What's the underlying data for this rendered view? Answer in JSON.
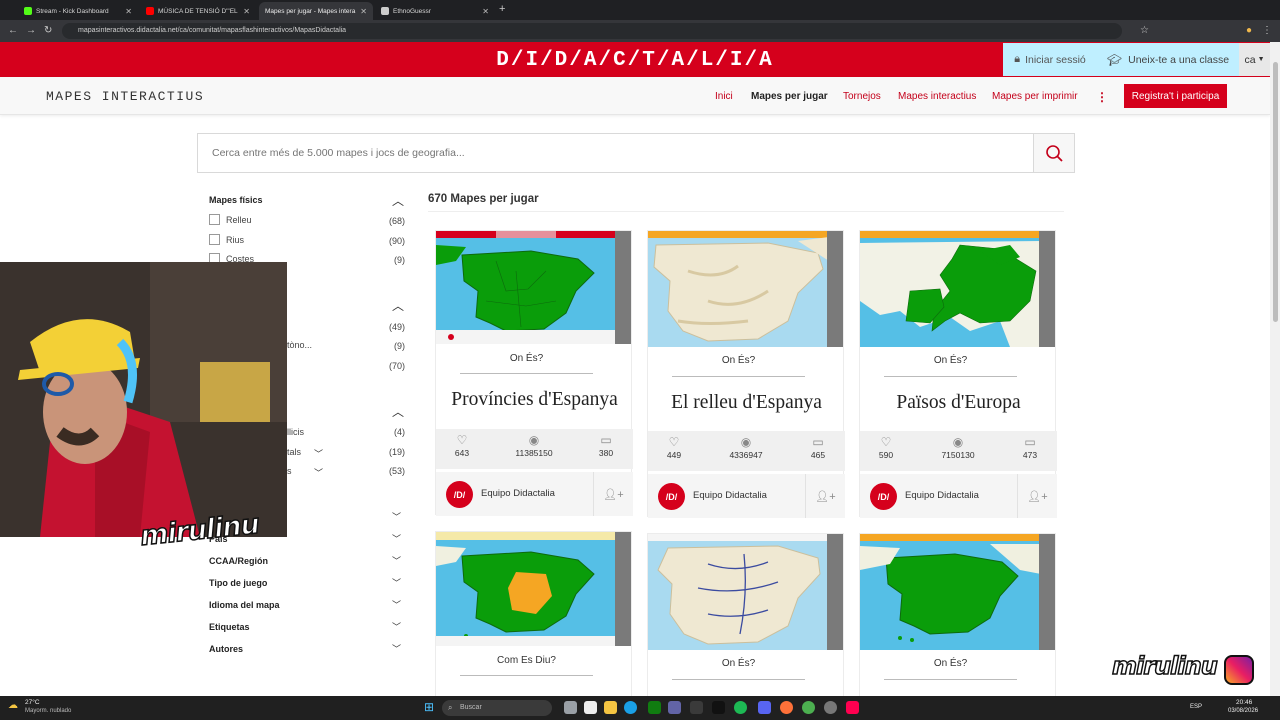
{
  "browser": {
    "tabs": [
      {
        "label": "Stream - Kick Dashboard",
        "active": false,
        "color": "#53fc18"
      },
      {
        "label": "MÚSICA DE TENSIÓ D'\"EL",
        "active": false,
        "color": "#ff0000"
      },
      {
        "label": "Mapes per jugar - Mapes intera",
        "active": true,
        "color": "#999999"
      },
      {
        "label": "EthnoGuessr",
        "active": false,
        "color": "#cccccc"
      }
    ],
    "url": "mapasinteractivos.didactalia.net/ca/comunitat/mapasflashinteractivos/MapasDidactalia"
  },
  "site": {
    "logo": "D/I/D/A/C/T/A/L/I/A",
    "login_label": "Iniciar sessió",
    "join_label": "Uneix-te a una classe",
    "lang": "ca",
    "name": "MAPES INTERACTIUS",
    "nav": [
      "Inici",
      "Mapes per jugar",
      "Tornejos",
      "Mapes interactius",
      "Mapes per imprimir"
    ],
    "register_label": "Registra't i participa",
    "search_placeholder": "Cerca entre més de 5.000 mapes i jocs de geografia..."
  },
  "sidebar": {
    "section1": {
      "title": "Mapes físics",
      "items": [
        {
          "label": "Relleu",
          "count": "(68)"
        },
        {
          "label": "Rius",
          "count": "(90)"
        },
        {
          "label": "Costes",
          "count": "(9)"
        }
      ]
    },
    "section2_partial": [
      {
        "label": "",
        "count": "(49)"
      },
      {
        "label": "tòno...",
        "count": "(9)"
      },
      {
        "label": "",
        "count": "(70)"
      }
    ],
    "section3_partial": [
      {
        "label": "llicis",
        "count": "(4)"
      },
      {
        "label": "tals",
        "count": "(19)"
      },
      {
        "label": "s",
        "count": "(53)"
      }
    ],
    "categories": [
      "País",
      "CCAA/Región",
      "Tipo de juego",
      "Idioma del mapa",
      "Etiquetas",
      "Autores"
    ]
  },
  "results": {
    "title": "670 Mapes per jugar",
    "cards": [
      {
        "question": "On És?",
        "title": "Províncies d'Espanya",
        "likes": "643",
        "views": "11385150",
        "comments": "380",
        "author": "Equipo Didactalia"
      },
      {
        "question": "On És?",
        "title": "El relleu d'Espanya",
        "likes": "449",
        "views": "4336947",
        "comments": "465",
        "author": "Equipo Didactalia"
      },
      {
        "question": "On És?",
        "title": "Països d'Europa",
        "likes": "590",
        "views": "7150130",
        "comments": "473",
        "author": "Equipo Didactalia"
      },
      {
        "question": "Com Es Diu?",
        "title": "",
        "likes": "",
        "views": "",
        "comments": "",
        "author": ""
      },
      {
        "question": "On És?",
        "title": "",
        "likes": "",
        "views": "",
        "comments": "",
        "author": ""
      },
      {
        "question": "On És?",
        "title": "",
        "likes": "",
        "views": "",
        "comments": "",
        "author": ""
      }
    ],
    "avatar_text": "/D/"
  },
  "overlay": {
    "watermark": "mirulinu"
  },
  "taskbar": {
    "weather_temp": "27°C",
    "weather_desc": "Mayorm. nublado",
    "search_label": "Buscar",
    "lang": "ESP",
    "time": "20:46",
    "date": "03/08/2026"
  },
  "colors": {
    "brand_red": "#d5001c",
    "light_blue": "#bfefff",
    "map_sea": "#55bfe6",
    "map_green": "#0a9d0a"
  }
}
